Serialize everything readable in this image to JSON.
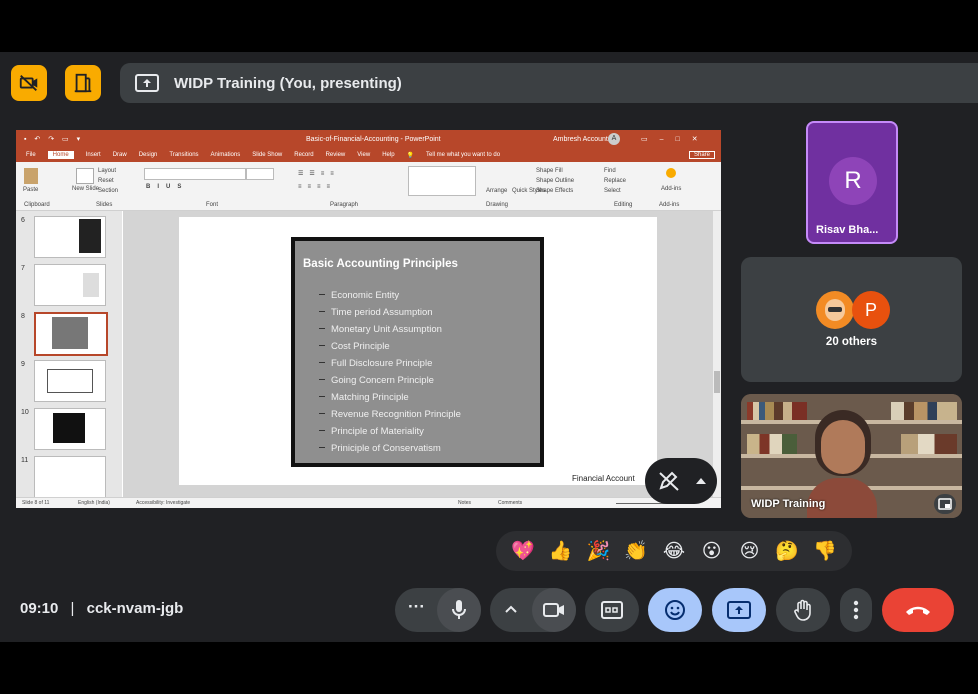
{
  "topbar": {
    "presenting_label": "WIDP Training (You, presenting)"
  },
  "ppt": {
    "window_title": "Basic-of-Financial-Accounting - PowerPoint",
    "account": "Ambresh Accounts",
    "account_initial": "A",
    "tabs": [
      "File",
      "Home",
      "Insert",
      "Draw",
      "Design",
      "Transitions",
      "Animations",
      "Slide Show",
      "Record",
      "Review",
      "View",
      "Help"
    ],
    "tell_me": "Tell me what you want to do",
    "share_label": "Share",
    "ribbon": {
      "paste": "Paste",
      "new_slide": "New Slide",
      "layout": "Layout",
      "reset": "Reset",
      "section": "Section",
      "groups": [
        "Clipboard",
        "Slides",
        "Font",
        "Paragraph",
        "Drawing",
        "Editing",
        "Add-ins"
      ],
      "arrange": "Arrange",
      "quick_styles": "Quick Styles",
      "shape_fill": "Shape Fill",
      "shape_outline": "Shape Outline",
      "shape_effects": "Shape Effects",
      "find": "Find",
      "replace": "Replace",
      "select": "Select",
      "add_ins": "Add-ins"
    },
    "slide_numbers": [
      "6",
      "7",
      "8",
      "9",
      "10",
      "11"
    ],
    "slide": {
      "title": "Basic Accounting Principles",
      "bullets": [
        "Economic Entity",
        "Time period Assumption",
        "Monetary Unit Assumption",
        "Cost Principle",
        "Full Disclosure Principle",
        "Going Concern Principle",
        "Matching Principle",
        "Revenue Recognition Principle",
        "Principle of Materiality",
        "Priniciple of Conservatism"
      ]
    },
    "footer_text": "Financial Account",
    "status": {
      "slide_of": "Slide 8 of 11",
      "language": "English (India)",
      "accessibility": "Accessibility: Investigate",
      "notes": "Notes",
      "comments": "Comments"
    }
  },
  "participants": {
    "featured": {
      "initial": "R",
      "name": "Risav Bha...",
      "color": "#7030a0"
    },
    "others": {
      "initial": "P",
      "label": "20 others"
    },
    "self_video": {
      "name": "WIDP Training"
    }
  },
  "reactions": [
    "💖",
    "👍",
    "🎉",
    "👏",
    "😂",
    "😮",
    "😢",
    "🤔",
    "👎"
  ],
  "meeting": {
    "time": "09:10",
    "separator": "|",
    "code": "cck-nvam-jgb"
  },
  "colors": {
    "accent_yellow": "#f9ab00",
    "ppt_orange": "#b7472a",
    "control_active": "#a8c7fa",
    "end_call": "#ea4335"
  }
}
